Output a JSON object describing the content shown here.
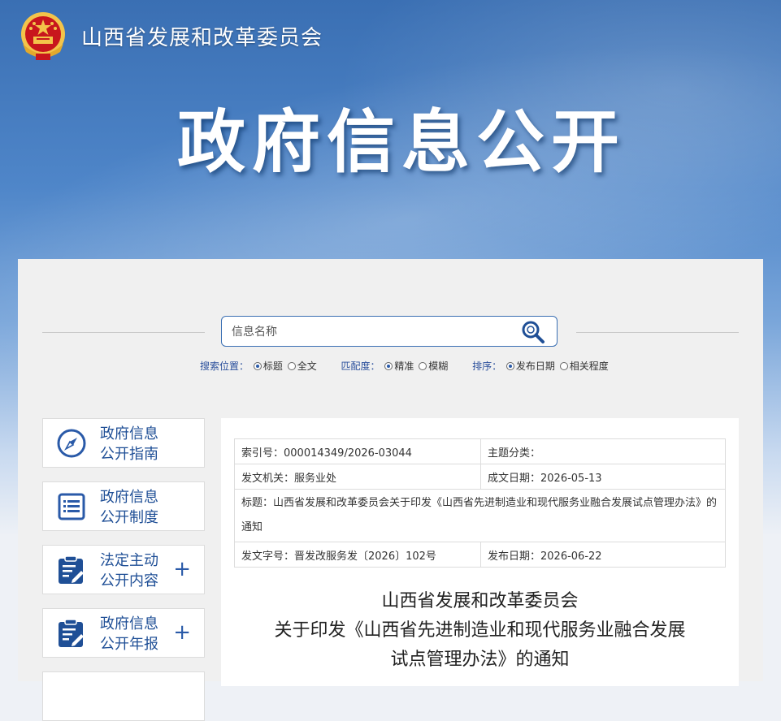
{
  "header": {
    "site_name": "山西省发展和改革委员会",
    "banner_title": "政府信息公开"
  },
  "search": {
    "placeholder": "信息名称",
    "options": [
      {
        "label": "搜索位置：",
        "choices": [
          {
            "text": "标题",
            "selected": true
          },
          {
            "text": "全文",
            "selected": false
          }
        ]
      },
      {
        "label": "匹配度：",
        "choices": [
          {
            "text": "精准",
            "selected": true
          },
          {
            "text": "模糊",
            "selected": false
          }
        ]
      },
      {
        "label": "排序：",
        "choices": [
          {
            "text": "发布日期",
            "selected": true
          },
          {
            "text": "相关程度",
            "selected": false
          }
        ]
      }
    ]
  },
  "sidebar": {
    "items": [
      {
        "line1": "政府信息",
        "line2": "公开指南",
        "icon": "compass-icon",
        "expandable": false
      },
      {
        "line1": "政府信息",
        "line2": "公开制度",
        "icon": "document-list-icon",
        "expandable": false
      },
      {
        "line1": "法定主动",
        "line2": "公开内容",
        "icon": "clipboard-edit-icon",
        "expandable": true
      },
      {
        "line1": "政府信息",
        "line2": "公开年报",
        "icon": "clipboard-edit-icon",
        "expandable": true
      }
    ],
    "expand_symbol": "+"
  },
  "meta": {
    "index_no": "索引号：000014349/2026-03044",
    "topic": "主题分类：",
    "issuer": "发文机关：服务业处",
    "created": "成文日期：2026-05-13",
    "title": "标题：山西省发展和改革委员会关于印发《山西省先进制造业和现代服务业融合发展试点管理办法》的通知",
    "doc_no": "发文字号：晋发改服务发〔2026〕102号",
    "published": "发布日期：2026-06-22"
  },
  "document": {
    "title_line1": "山西省发展和改革委员会",
    "title_line2": "关于印发《山西省先进制造业和现代服务业融合发展",
    "title_line3": "试点管理办法》的通知"
  },
  "colors": {
    "accent": "#1f4f96",
    "banner": "#3a6fb3",
    "emblem_red": "#c8161d",
    "emblem_gold": "#f3c44a"
  }
}
